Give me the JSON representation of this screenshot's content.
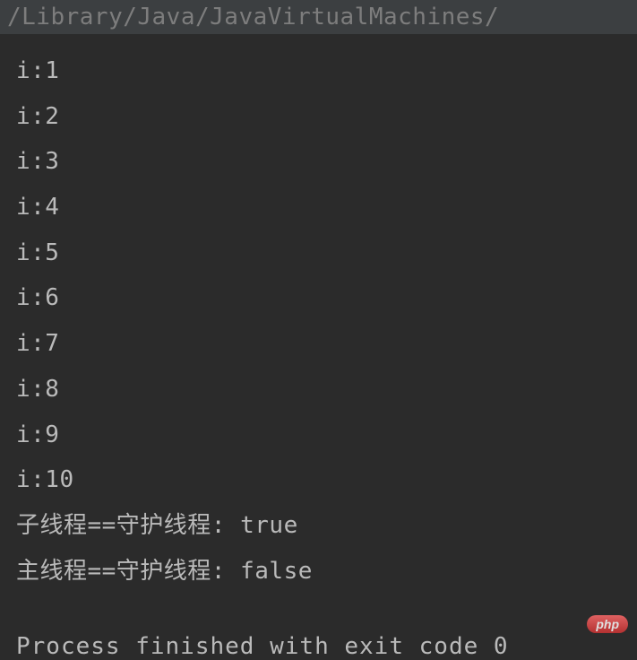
{
  "command_line": "/Library/Java/JavaVirtualMachines/",
  "output_lines": [
    "i:1",
    "i:2",
    "i:3",
    "i:4",
    "i:5",
    "i:6",
    "i:7",
    "i:8",
    "i:9",
    "i:10",
    "子线程==守护线程: true",
    "主线程==守护线程: false"
  ],
  "exit_message": "Process finished with exit code 0",
  "watermark": "php"
}
